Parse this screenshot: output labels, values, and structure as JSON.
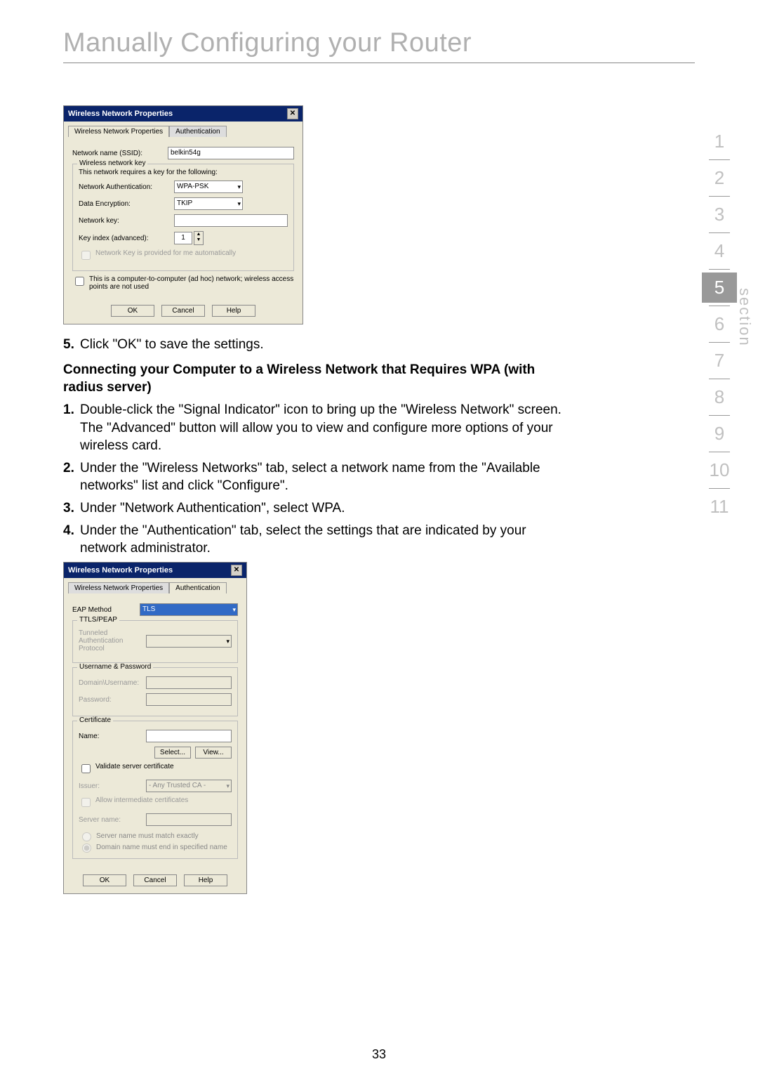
{
  "page_title": "Manually Configuring your Router",
  "page_number": "33",
  "section_label": "section",
  "section_numbers": [
    "1",
    "2",
    "3",
    "4",
    "5",
    "6",
    "7",
    "8",
    "9",
    "10",
    "11"
  ],
  "active_section": "5",
  "dialog1": {
    "title": "Wireless Network Properties",
    "tab1": "Wireless Network Properties",
    "tab2": "Authentication",
    "fields": {
      "ssid_label": "Network name (SSID):",
      "ssid_value": "belkin54g",
      "wnk_legend": "Wireless network key",
      "wnk_desc": "This network requires a key for the following:",
      "auth_label": "Network Authentication:",
      "auth_value": "WPA-PSK",
      "enc_label": "Data Encryption:",
      "enc_value": "TKIP",
      "key_label": "Network key:",
      "key_value": "",
      "keyidx_label": "Key index (advanced):",
      "keyidx_value": "1",
      "auto_cb": "Network Key is provided for me automatically",
      "adhoc_cb": "This is a computer-to-computer (ad hoc) network; wireless access points are not used"
    },
    "buttons": {
      "ok": "OK",
      "cancel": "Cancel",
      "help": "Help"
    }
  },
  "instr": {
    "step5": "Click \"OK\" to save the settings.",
    "subheading": "Connecting your Computer to a Wireless Network that Requires WPA (with radius server)",
    "step1": "Double-click the \"Signal Indicator\" icon to bring up the \"Wireless Network\" screen. The \"Advanced\" button will allow you to view and configure more options of your wireless card.",
    "step2": "Under the \"Wireless Networks\" tab, select a network name from the \"Available networks\" list and click \"Configure\".",
    "step3": "Under \"Network Authentication\", select WPA.",
    "step4": "Under the \"Authentication\" tab, select the settings that are indicated by your network administrator."
  },
  "dialog2": {
    "title": "Wireless Network Properties",
    "tab1": "Wireless Network Properties",
    "tab2": "Authentication",
    "fields": {
      "eap_label": "EAP Method",
      "eap_value": "TLS",
      "ttls_legend": "TTLS/PEAP",
      "tunneled_label": "Tunneled Authentication Protocol",
      "userpw_legend": "Username & Password",
      "domain_label": "Domain\\Username:",
      "password_label": "Password:",
      "cert_legend": "Certificate",
      "name_label": "Name:",
      "select_btn": "Select...",
      "view_btn": "View...",
      "validate_cb": "Validate server certificate",
      "issuer_label": "Issuer:",
      "issuer_value": "- Any Trusted CA -",
      "allow_cb": "Allow intermediate certificates",
      "server_label": "Server name:",
      "radio_exact": "Server name must match exactly",
      "radio_end": "Domain name must end in specified name"
    },
    "buttons": {
      "ok": "OK",
      "cancel": "Cancel",
      "help": "Help"
    }
  }
}
